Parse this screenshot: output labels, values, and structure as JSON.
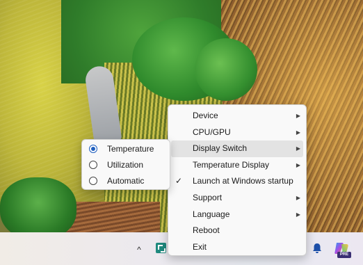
{
  "menu": {
    "items": [
      {
        "label": "Device",
        "submenu": true
      },
      {
        "label": "CPU/GPU",
        "submenu": true
      },
      {
        "label": "Display Switch",
        "submenu": true,
        "highlighted": true
      },
      {
        "label": "Temperature Display",
        "submenu": true
      },
      {
        "label": "Launch at Windows startup",
        "checked": true
      },
      {
        "label": "Support",
        "submenu": true
      },
      {
        "label": "Language",
        "submenu": true
      },
      {
        "label": "Reboot"
      },
      {
        "label": "Exit"
      }
    ],
    "arrow_glyph": "▶",
    "check_glyph": "✓"
  },
  "display_switch_submenu": {
    "options": [
      "Temperature",
      "Utilization",
      "Automatic"
    ],
    "selected": "Temperature"
  },
  "taskbar": {
    "chevron_glyph": "^",
    "pre_badge": "PRE",
    "icons": [
      "show-hidden-icons-chevron-icon",
      "tray-app-icon",
      "notification-bell-icon",
      "copilot-icon"
    ]
  },
  "colors": {
    "menu_bg": "#f9f9f9",
    "hover_bg": "#e3e3e3",
    "radio_accent": "#1f5fbf",
    "tray_app": "#1f8a7e"
  }
}
